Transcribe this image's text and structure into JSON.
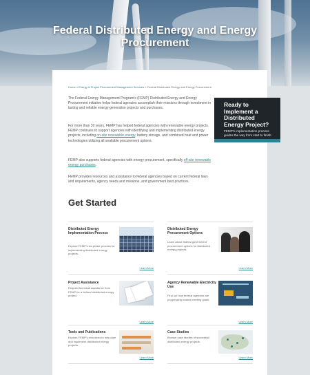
{
  "hero": {
    "title": "Federal Distributed Energy and Energy Procurement"
  },
  "breadcrumb": {
    "items": [
      "Home",
      "Energy & Project Procurement Management Services",
      "Federal Distributed Energy and Energy Procurement"
    ],
    "separator": "»"
  },
  "intro": {
    "p1": "The Federal Energy Management Program's (FEMP) Distributed Energy and Energy Procurement initiative helps federal agencies accomplish their missions through investment in lasting and reliable energy-generation projects and purchases.",
    "p2_before": "For more than 30 years, FEMP has helped federal agencies with renewable energy projects. FEMP continues to support agencies with identifying and implementing distributed energy projects, including ",
    "p2_link": "on-site renewable energy",
    "p2_after": ", battery storage, and combined heat and power technologies utilizing all available procurement options.",
    "p3_before": "FEMP also supports federal agencies with energy procurement, specifically ",
    "p3_link": "off-site renewable energy purchases",
    "p3_after": ".",
    "p4": "FEMP provides resources and assistance to federal agencies based on current federal laws and requirements, agency needs and missions, and government best practices."
  },
  "callout": {
    "title": "Ready to Implement a Distributed Energy Project?",
    "subtitle": "FEMP's implementation process guides the way from start to finish."
  },
  "section": {
    "heading": "Get Started"
  },
  "tiles": [
    {
      "title": "Distributed Energy Implementation Process",
      "desc": "Explore FEMP's six-phase process for implementing distributed energy projects.",
      "more": "Learn More",
      "image": "solar-panels"
    },
    {
      "title": "Distributed Energy Procurement Options",
      "desc": "Learn about federal government procurement options for distributed energy projects.",
      "more": "Learn More",
      "image": "people-meeting"
    },
    {
      "title": "Project Assistance",
      "desc": "Request technical assistance from FEMP for a federal distributed energy project.",
      "more": "Learn More",
      "image": "documents"
    },
    {
      "title": "Agency Renewable Electricity Use",
      "desc": "Find out how federal agencies are progressing toward meeting goals.",
      "more": "Learn More",
      "image": "map-chart"
    },
    {
      "title": "Tools and Publications",
      "desc": "Explore FEMP's resources to help plan and implement distributed energy projects.",
      "more": "Learn More",
      "image": "tools"
    },
    {
      "title": "Case Studies",
      "desc": "Browse case studies of successful distributed energy projects.",
      "more": "Learn More",
      "image": "map"
    }
  ],
  "colors": {
    "link": "#2e8a8a",
    "callout_bg": "#1f2528",
    "callout_accent": "#2f7f98",
    "side_gray": "#dfe3e6"
  }
}
